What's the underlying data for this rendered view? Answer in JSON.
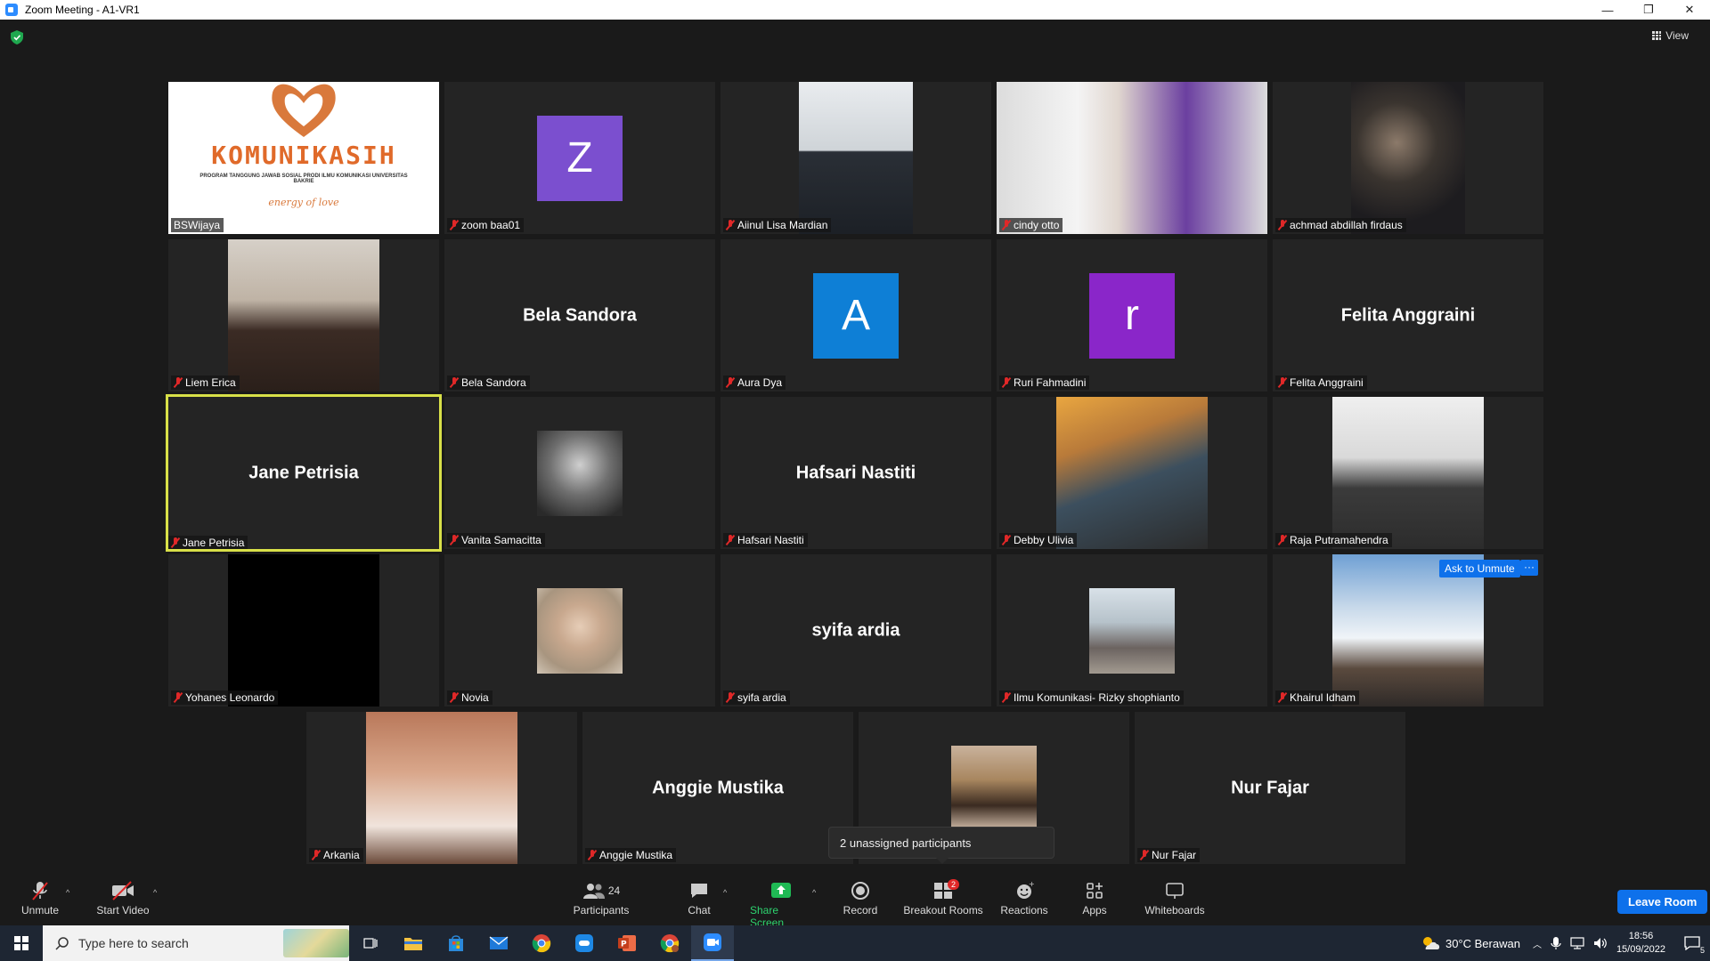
{
  "window": {
    "title": "Zoom Meeting - A1-VR1",
    "minimize": "—",
    "restore": "❐",
    "close": "✕"
  },
  "header": {
    "view_label": "View"
  },
  "tiles": [
    {
      "name": "BSWijaya",
      "muted": false,
      "kind": "logo",
      "logo_text": "KOMUNIKASIH",
      "logo_sub": "PROGRAM TANGGUNG JAWAB SOSIAL PRODI ILMU KOMUNIKASI UNIVERSITAS BAKRIE",
      "logo_script": "energy of love"
    },
    {
      "name": "zoom baa01",
      "muted": true,
      "kind": "letter",
      "letter": "Z",
      "color": "#7b4fcf"
    },
    {
      "name": "Aiinul Lisa Mardian",
      "muted": true,
      "kind": "photo",
      "photo": "webcam"
    },
    {
      "name": "cindy otto",
      "muted": true,
      "kind": "photo",
      "photo": "webcam-wide"
    },
    {
      "name": "achmad abdillah firdaus",
      "muted": true,
      "kind": "photo",
      "photo": "webcam-dark"
    },
    {
      "name": "Liem Erica",
      "muted": true,
      "kind": "photo",
      "photo": "portrait"
    },
    {
      "name": "Bela Sandora",
      "muted": true,
      "kind": "name",
      "display": "Bela Sandora"
    },
    {
      "name": "Aura Dya",
      "muted": true,
      "kind": "letter",
      "letter": "A",
      "color": "#0e7fd6"
    },
    {
      "name": "Ruri Fahmadini",
      "muted": true,
      "kind": "letter",
      "letter": "r",
      "color": "#8a26c9"
    },
    {
      "name": "Felita Anggraini",
      "muted": true,
      "kind": "name",
      "display": "Felita Anggraini"
    },
    {
      "name": "Jane Petrisia",
      "muted": true,
      "kind": "name",
      "display": "Jane Petrisia",
      "speaking": true
    },
    {
      "name": "Vanita Samacitta",
      "muted": true,
      "kind": "photo",
      "photo": "avatar-bw"
    },
    {
      "name": "Hafsari Nastiti",
      "muted": true,
      "kind": "name",
      "display": "Hafsari Nastiti"
    },
    {
      "name": "Debby Ulivia",
      "muted": true,
      "kind": "photo",
      "photo": "cafe"
    },
    {
      "name": "Raja Putramahendra",
      "muted": true,
      "kind": "photo",
      "photo": "reading"
    },
    {
      "name": "Yohanes Leonardo",
      "muted": true,
      "kind": "photo",
      "photo": "black"
    },
    {
      "name": "Novia",
      "muted": true,
      "kind": "photo",
      "photo": "avatar-hijab"
    },
    {
      "name": "syifa ardia",
      "muted": true,
      "kind": "name",
      "display": "syifa ardia"
    },
    {
      "name": "Ilmu Komunikasi- Rizky shophianto",
      "muted": true,
      "kind": "photo",
      "photo": "avatar-outdoor"
    },
    {
      "name": "Khairul Idham",
      "muted": true,
      "kind": "photo",
      "photo": "mountain"
    },
    {
      "name": "Arkania",
      "muted": true,
      "kind": "photo",
      "photo": "selfie"
    },
    {
      "name": "Anggie Mustika",
      "muted": true,
      "kind": "name",
      "display": "Anggie Mustika"
    },
    {
      "name": "",
      "muted": false,
      "kind": "photo",
      "photo": "mirror"
    },
    {
      "name": "Nur Fajar",
      "muted": true,
      "kind": "name",
      "display": "Nur Fajar"
    }
  ],
  "hover": {
    "ask_unmute": "Ask to Unmute",
    "more": "···"
  },
  "tooltip": "2 unassigned participants",
  "toolbar": {
    "unmute": "Unmute",
    "start_video": "Start Video",
    "participants": "Participants",
    "participants_count": "24",
    "chat": "Chat",
    "share_screen": "Share Screen",
    "record": "Record",
    "breakout_rooms": "Breakout Rooms",
    "breakout_badge": "2",
    "reactions": "Reactions",
    "apps": "Apps",
    "whiteboards": "Whiteboards",
    "leave": "Leave Room"
  },
  "taskbar": {
    "search_placeholder": "Type here to search",
    "weather": "30°C  Berawan",
    "time": "18:56",
    "date": "15/09/2022",
    "notif_count": "5"
  },
  "colors": {
    "accent": "#0e71eb",
    "muted": "#e02828",
    "speaker_border": "#d8e048",
    "tile_bg": "#242424"
  }
}
